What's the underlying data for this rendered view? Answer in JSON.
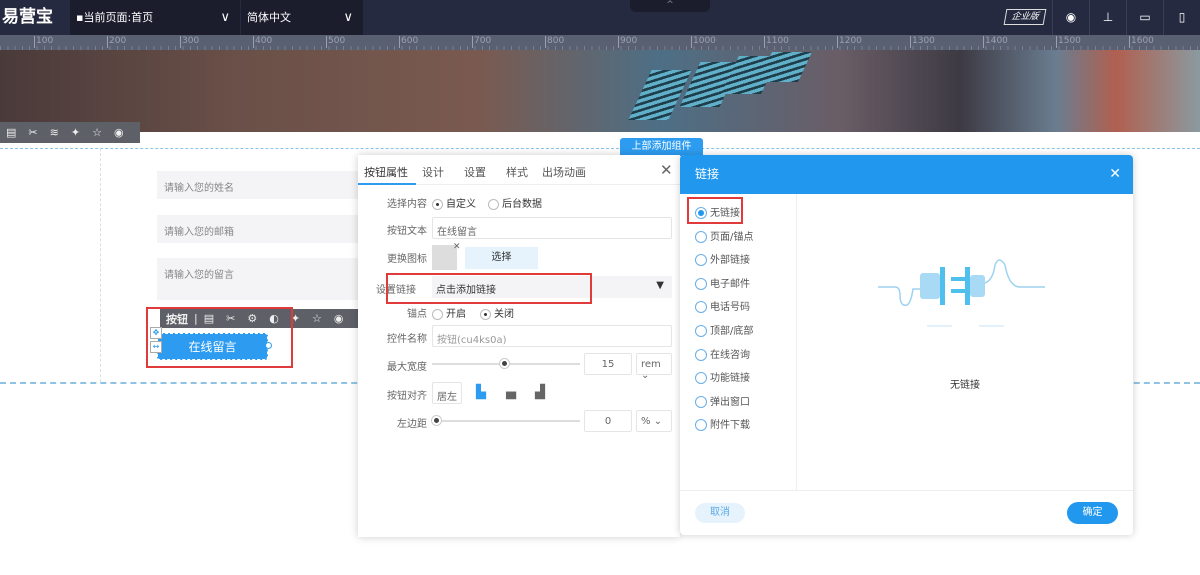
{
  "topbar": {
    "logo": "易营宝",
    "page_selector": "当前页面:首页",
    "language": "简体中文",
    "edition": "企业版"
  },
  "ruler": [
    "100",
    "200",
    "300",
    "400",
    "500",
    "600",
    "700",
    "800",
    "900",
    "1000",
    "1100",
    "1200",
    "1300",
    "1400",
    "1500",
    "1600"
  ],
  "canvas": {
    "name_placeholder": "请输入您的姓名",
    "email_placeholder": "请输入您的邮箱",
    "message_placeholder": "请输入您的留言",
    "button_toolbar_label": "按钮",
    "button_text": "在线留言",
    "add_component": "上部添加组件"
  },
  "panel": {
    "tabs": [
      "按钮属性",
      "设计",
      "设置",
      "样式",
      "出场动画"
    ],
    "content_label": "选择内容",
    "content_options": [
      "自定义",
      "后台数据"
    ],
    "text_label": "按钮文本",
    "text_value": "在线留言",
    "icon_label": "更换图标",
    "icon_select": "选择",
    "link_label": "设置链接",
    "link_value": "点击添加链接",
    "anchor_label": "锚点",
    "anchor_options": [
      "开启",
      "关闭"
    ],
    "name_label": "控件名称",
    "name_placeholder": "按钮(cu4ks0a)",
    "width_label": "最大宽度",
    "width_value": "15",
    "width_unit": "rem",
    "align_label": "按钮对齐",
    "align_value": "居左",
    "margin_label": "左边距",
    "margin_value": "0",
    "margin_unit": "%"
  },
  "dialog": {
    "title": "链接",
    "options": [
      "无链接",
      "页面/锚点",
      "外部链接",
      "电子邮件",
      "电话号码",
      "顶部/底部",
      "在线咨询",
      "功能链接",
      "弹出窗口",
      "附件下载"
    ],
    "selected": 0,
    "preview_label": "无链接",
    "cancel": "取消",
    "confirm": "确定"
  },
  "colors": {
    "accent": "#2d9cf0",
    "topbar": "#262a40",
    "highlight": "#e03a3a"
  }
}
